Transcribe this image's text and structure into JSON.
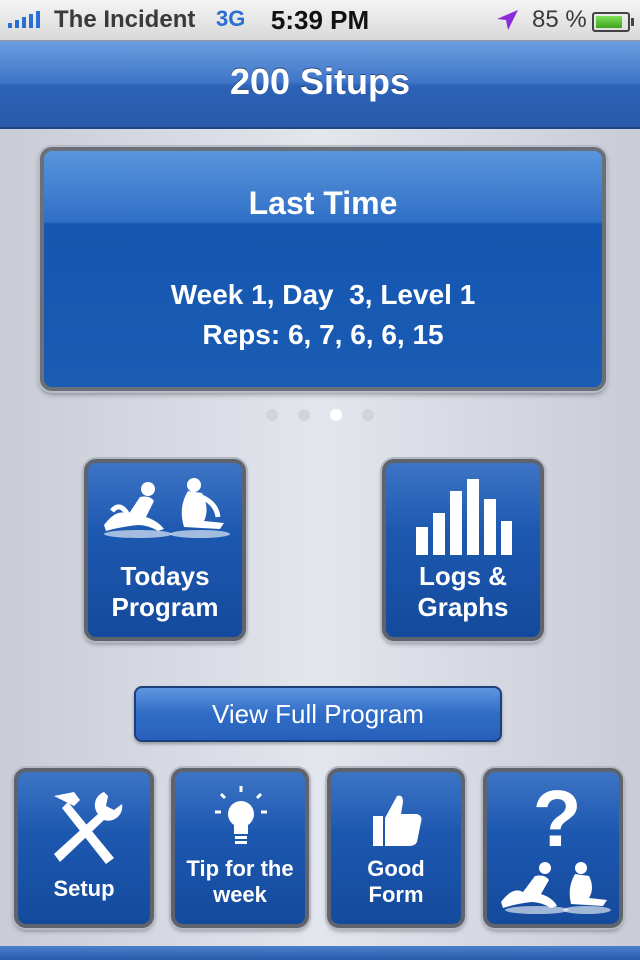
{
  "status_bar": {
    "carrier": "The Incident",
    "network": "3G",
    "time": "5:39 PM",
    "battery_percent": "85 %",
    "battery_level": 0.85,
    "icons": [
      "signal-bars-icon",
      "location-arrow-icon",
      "battery-icon"
    ]
  },
  "nav": {
    "title": "200 Situps"
  },
  "last_time": {
    "title": "Last Time",
    "line1": "Week 1, Day  3, Level 1",
    "line2": "Reps: 6, 7, 6, 6, 15"
  },
  "pager": {
    "count": 4,
    "active": 3
  },
  "tiles": {
    "todays_program": {
      "label_line1": "Todays",
      "label_line2": "Program",
      "icon": "situp-figures-icon"
    },
    "logs_graphs": {
      "label_line1": "Logs &",
      "label_line2": "Graphs",
      "icon": "bar-graph-icon"
    },
    "setup": {
      "label": "Setup",
      "icon": "hammer-wrench-icon"
    },
    "tip": {
      "label_line1": "Tip for the",
      "label_line2": "week",
      "icon": "light-bulb-icon"
    },
    "good_form": {
      "label_line1": "Good",
      "label_line2": "Form",
      "icon": "thumbs-up-icon"
    },
    "help": {
      "icon": "question-mark-situp-icon"
    }
  },
  "view_full_program": {
    "label": "View Full Program"
  },
  "colors": {
    "accent": "#2a5bab",
    "status_accent": "#2a6fd1"
  }
}
